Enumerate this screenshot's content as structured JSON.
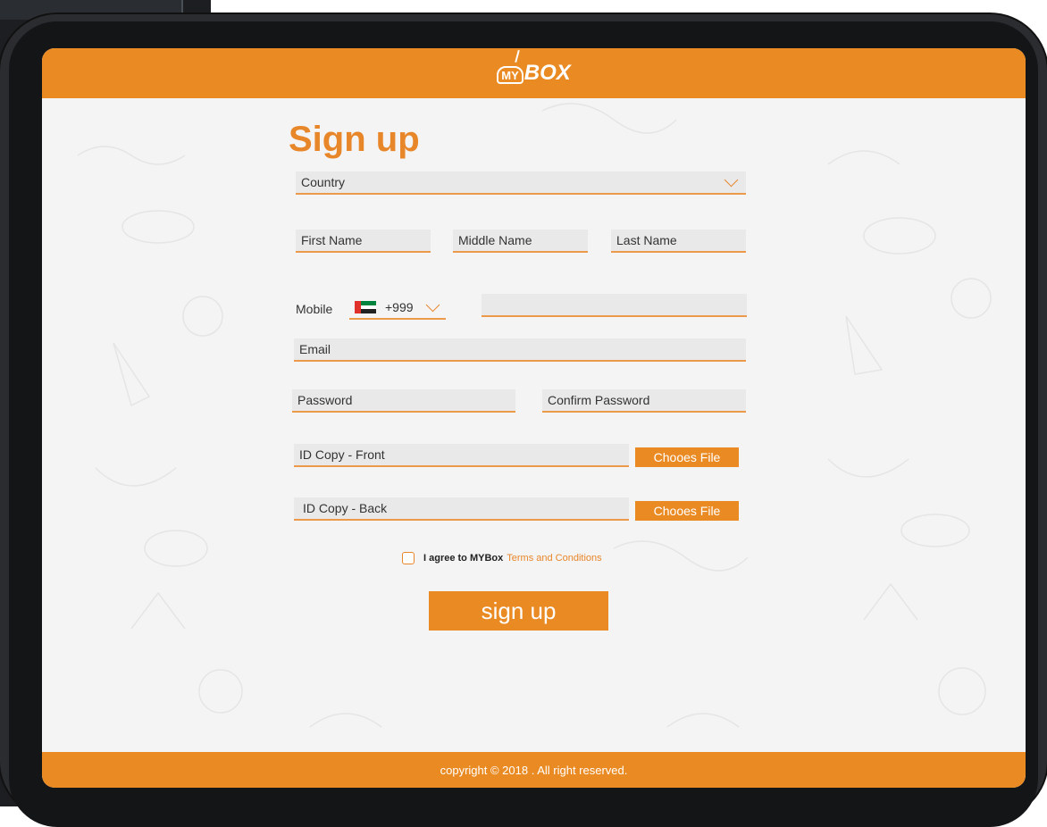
{
  "brand": {
    "logo_my": "MY",
    "logo_box": "BOX"
  },
  "page": {
    "title": "Sign up"
  },
  "form": {
    "country_placeholder": "Country",
    "first_name_placeholder": "First Name",
    "middle_name_placeholder": "Middle Name",
    "last_name_placeholder": "Last Name",
    "mobile_label": "Mobile",
    "phone_code": "+999",
    "mobile_value": "",
    "email_placeholder": "Email",
    "password_placeholder": "Password",
    "confirm_password_placeholder": "Confirm Password",
    "id_front_placeholder": "ID Copy - Front",
    "id_back_placeholder": "ID Copy - Back",
    "choose_file_label": "Chooes File",
    "agree_text": "I agree to MYBox",
    "terms_link": "Terms and Conditions",
    "submit_label": "sign up"
  },
  "footer": {
    "text": "copyright © 2018 . All right reserved."
  },
  "colors": {
    "accent": "#ea8a22",
    "field_bg": "#e9e9e9",
    "screen_bg": "#f4f4f4",
    "bezel": "#1c1e22"
  },
  "icons": {
    "country_dropdown": "chevron-down-icon",
    "phone_code_dropdown": "chevron-down-icon",
    "phone_flag": "uae-flag-icon"
  }
}
